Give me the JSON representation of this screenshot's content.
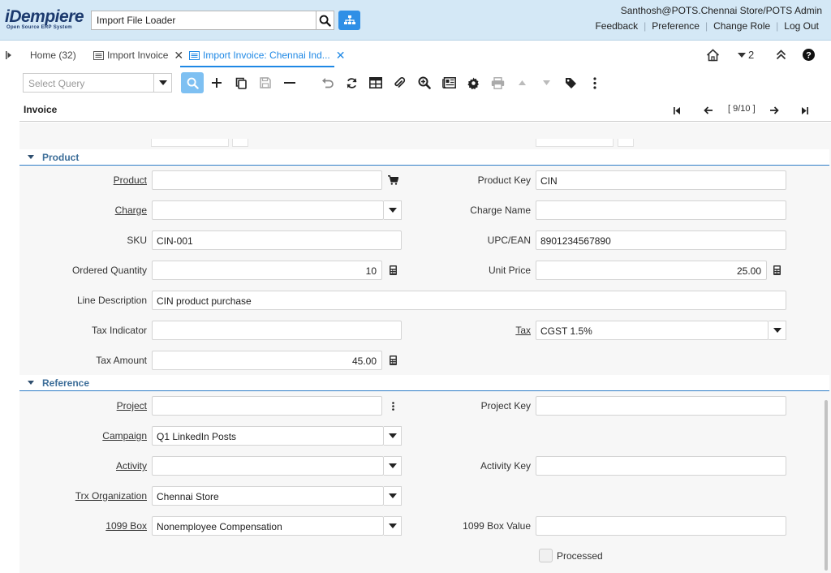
{
  "header": {
    "brand": "iDempiere",
    "tagline": "Open Source ERP System",
    "search_value": "Import File Loader",
    "user": "Santhosh@POTS.Chennai Store/POTS Admin",
    "links": [
      "Feedback",
      "Preference",
      "Change Role",
      "Log Out"
    ]
  },
  "tabs": [
    {
      "label": "Home (32)"
    },
    {
      "label": "Import Invoice"
    },
    {
      "label": "Import Invoice: Chennai Ind..."
    }
  ],
  "tabbar_right": {
    "notification_count": "2"
  },
  "toolbar": {
    "query_placeholder": "Select Query"
  },
  "title": {
    "label": "Invoice",
    "record_counter": "[ 9/10 ]"
  },
  "sections": {
    "product": "Product",
    "reference": "Reference"
  },
  "product": {
    "product_label": "Product",
    "product_value": "",
    "product_key_label": "Product Key",
    "product_key_value": "CIN",
    "charge_label": "Charge",
    "charge_value": "",
    "charge_name_label": "Charge Name",
    "charge_name_value": "",
    "sku_label": "SKU",
    "sku_value": "CIN-001",
    "upc_label": "UPC/EAN",
    "upc_value": "8901234567890",
    "ordered_qty_label": "Ordered Quantity",
    "ordered_qty_value": "10",
    "unit_price_label": "Unit Price",
    "unit_price_value": "25.00",
    "line_desc_label": "Line Description",
    "line_desc_value": "CIN product purchase",
    "tax_indicator_label": "Tax Indicator",
    "tax_indicator_value": "",
    "tax_label": "Tax",
    "tax_value": "CGST 1.5%",
    "tax_amount_label": "Tax Amount",
    "tax_amount_value": "45.00"
  },
  "reference": {
    "project_label": "Project",
    "project_value": "",
    "project_key_label": "Project Key",
    "project_key_value": "",
    "campaign_label": "Campaign",
    "campaign_value": "Q1 LinkedIn Posts",
    "activity_label": "Activity",
    "activity_value": "",
    "activity_key_label": "Activity Key",
    "activity_key_value": "",
    "trx_org_label": "Trx Organization",
    "trx_org_value": "Chennai Store",
    "box1099_label": "1099 Box",
    "box1099_value": "Nonemployee Compensation",
    "box1099_value_label": "1099 Box Value",
    "box1099_value_value": "",
    "processed_label": "Processed"
  },
  "colors": {
    "header_bg": "#d4e8f6",
    "accent": "#1e88e5",
    "section_title": "#3d6e99"
  }
}
